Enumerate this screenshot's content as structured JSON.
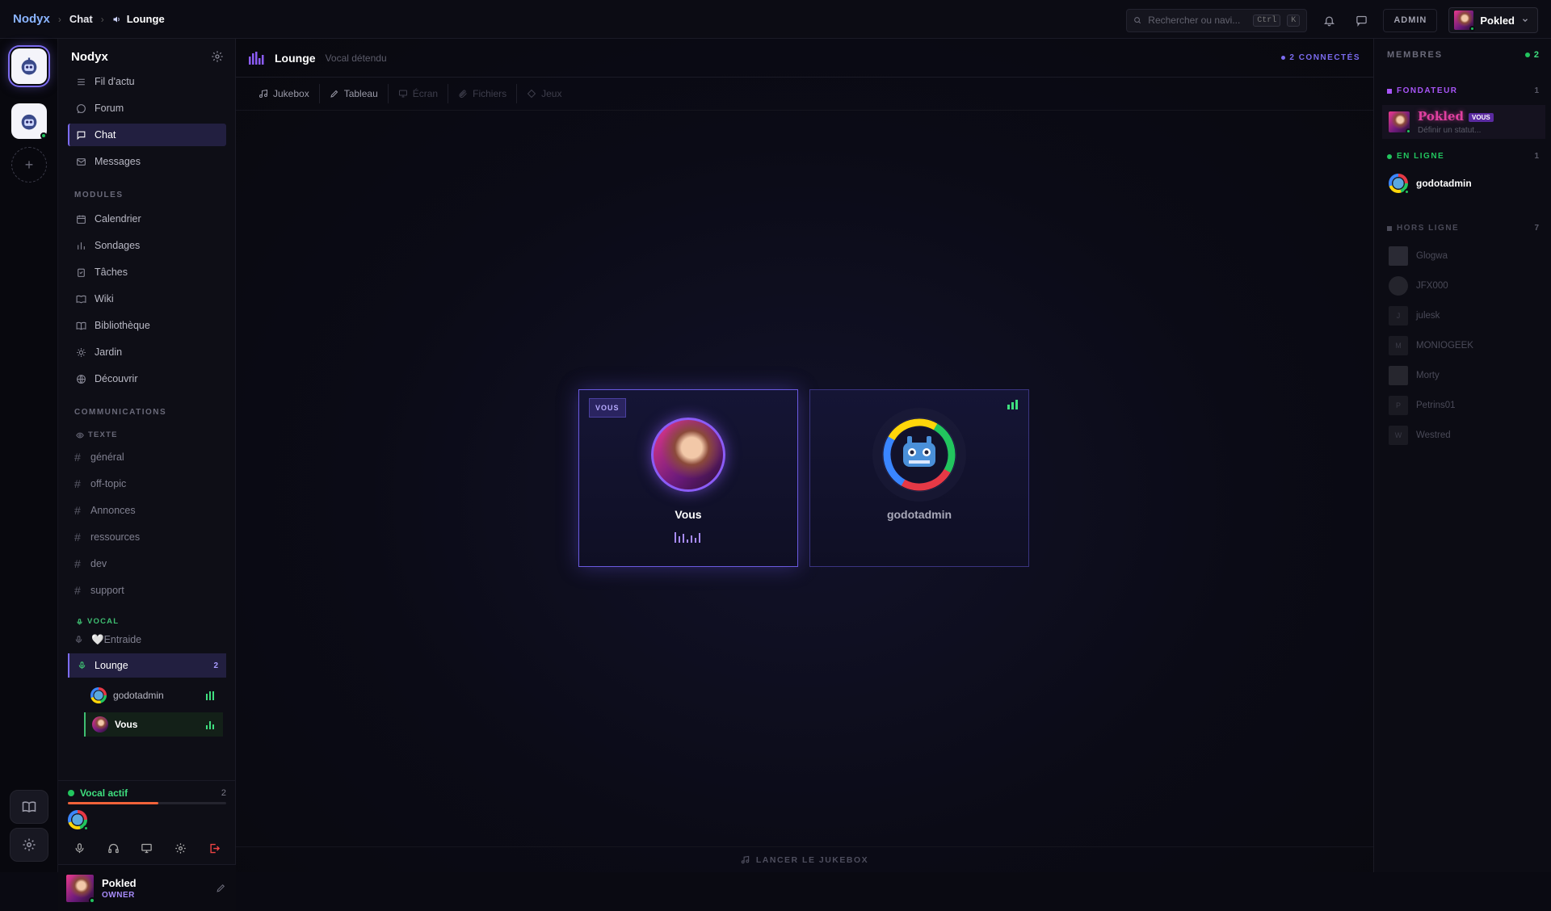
{
  "breadcrumb": {
    "brand": "Nodyx",
    "section": "Chat",
    "current": "Lounge"
  },
  "search": {
    "placeholder": "Rechercher ou navi...",
    "kbd1": "Ctrl",
    "kbd2": "K"
  },
  "topbar": {
    "admin_label": "ADMIN",
    "user_name": "Pokled"
  },
  "sidebar": {
    "title": "Nodyx",
    "nav": [
      {
        "label": "Fil d'actu",
        "icon": "feed-icon"
      },
      {
        "label": "Forum",
        "icon": "forum-icon"
      },
      {
        "label": "Chat",
        "icon": "chat-icon",
        "active": true
      },
      {
        "label": "Messages",
        "icon": "mail-icon"
      }
    ],
    "modules_label": "MODULES",
    "modules": [
      {
        "label": "Calendrier",
        "icon": "calendar-icon"
      },
      {
        "label": "Sondages",
        "icon": "poll-icon"
      },
      {
        "label": "Tâches",
        "icon": "tasks-icon"
      },
      {
        "label": "Wiki",
        "icon": "wiki-icon"
      },
      {
        "label": "Bibliothèque",
        "icon": "library-icon"
      },
      {
        "label": "Jardin",
        "icon": "garden-icon"
      },
      {
        "label": "Découvrir",
        "icon": "discover-icon"
      }
    ],
    "comms_label": "COMMUNICATIONS",
    "text_label": "TEXTE",
    "text_channels": [
      "général",
      "off-topic",
      "Annonces",
      "ressources",
      "dev",
      "support"
    ],
    "vocal_label": "VOCAL",
    "vocal_channels": [
      {
        "label": "🤍Entraide"
      }
    ],
    "lounge": {
      "label": "Lounge",
      "count": "2"
    },
    "voice_users": [
      {
        "name": "godotadmin"
      },
      {
        "name": "Vous"
      }
    ],
    "voice_panel": {
      "status": "Vocal actif",
      "count": "2",
      "level": 0.57
    },
    "footer": {
      "name": "Pokled",
      "role": "OWNER"
    }
  },
  "channel": {
    "title": "Lounge",
    "subtitle": "Vocal détendu",
    "connected": "2 CONNECTÉS",
    "tabs": [
      {
        "label": "Jukebox",
        "icon": "music-icon",
        "disabled": false
      },
      {
        "label": "Tableau",
        "icon": "pen-icon",
        "disabled": false
      },
      {
        "label": "Écran",
        "icon": "screen-icon",
        "disabled": true
      },
      {
        "label": "Fichiers",
        "icon": "paperclip-icon",
        "disabled": true
      },
      {
        "label": "Jeux",
        "icon": "game-icon",
        "disabled": true
      }
    ],
    "cards": [
      {
        "name": "Vous",
        "badge": "VOUS"
      },
      {
        "name": "godotadmin"
      }
    ],
    "jukebox_cta": "LANCER LE JUKEBOX"
  },
  "members": {
    "title": "MEMBRES",
    "online_count": "2",
    "founder_group": {
      "label": "FONDATEUR",
      "count": "1",
      "color": "#a855f7"
    },
    "founder": {
      "name": "Pokled",
      "badge": "VOUS",
      "status": "Définir un statut..."
    },
    "online_group": {
      "label": "EN LIGNE",
      "count": "1",
      "color": "#22c55e"
    },
    "online": [
      {
        "name": "godotadmin"
      }
    ],
    "offline_group": {
      "label": "HORS LIGNE",
      "count": "7",
      "color": "#4a4a58"
    },
    "offline": [
      {
        "name": "Glogwa",
        "initial": ""
      },
      {
        "name": "JFX000",
        "initial": ""
      },
      {
        "name": "julesk",
        "initial": "J"
      },
      {
        "name": "MONIOGEEK",
        "initial": "M"
      },
      {
        "name": "Morty",
        "initial": ""
      },
      {
        "name": "Petrins01",
        "initial": "P"
      },
      {
        "name": "Westred",
        "initial": "W"
      }
    ]
  }
}
